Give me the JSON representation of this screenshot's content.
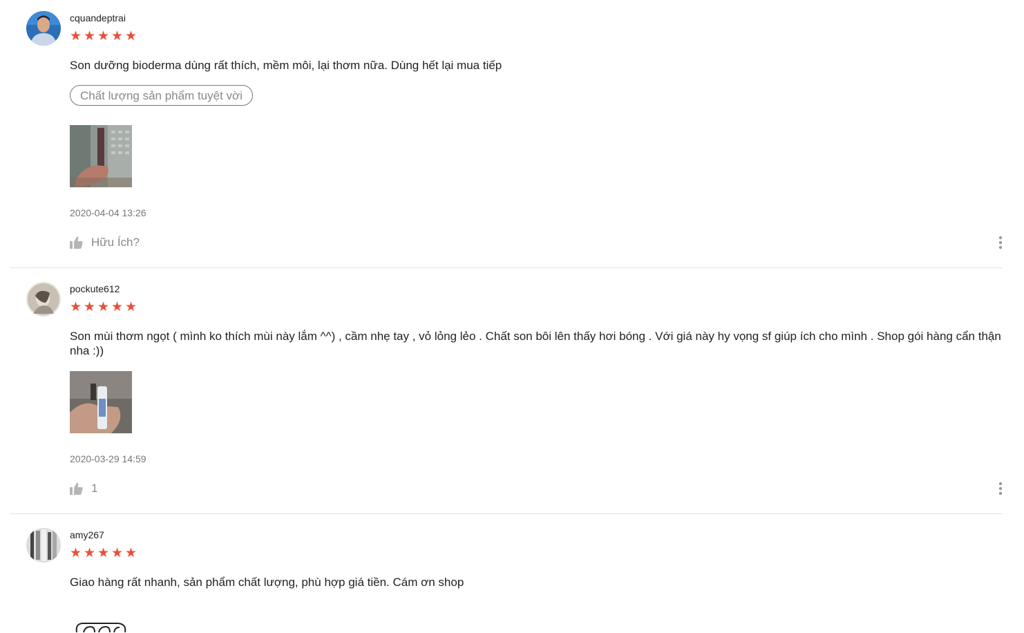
{
  "accent_color": "#e8503a",
  "reviews": [
    {
      "username": "cquandeptrai",
      "rating": 5,
      "comment": "Son dưỡng bioderma dùng rất thích, mềm môi, lại thơm nữa. Dùng hết lại mua tiếp",
      "tag": "Chất lượng sản phẩm tuyệt vời",
      "date": "2020-04-04 13:26",
      "like_label": "Hữu Ích?"
    },
    {
      "username": "pockute612",
      "rating": 5,
      "comment": "Son mùi thơm ngọt ( mình ko thích mùi này lắm ^^) , cầm nhẹ tay , vỏ lỏng lẻo . Chất son bôi lên thấy hơi bóng . Với giá này hy vọng sf giúp ích cho mình . Shop gói hàng cẩn thận nha :))",
      "date": "2020-03-29 14:59",
      "like_label": "1"
    },
    {
      "username": "amy267",
      "rating": 5,
      "comment": "Giao hàng rất nhanh, sản phẩm chất lượng, phù hợp giá tiền. Cám ơn shop"
    }
  ],
  "icons": {
    "star": "★",
    "like": "thumbs-up-icon",
    "more": "more-vertical-icon"
  }
}
